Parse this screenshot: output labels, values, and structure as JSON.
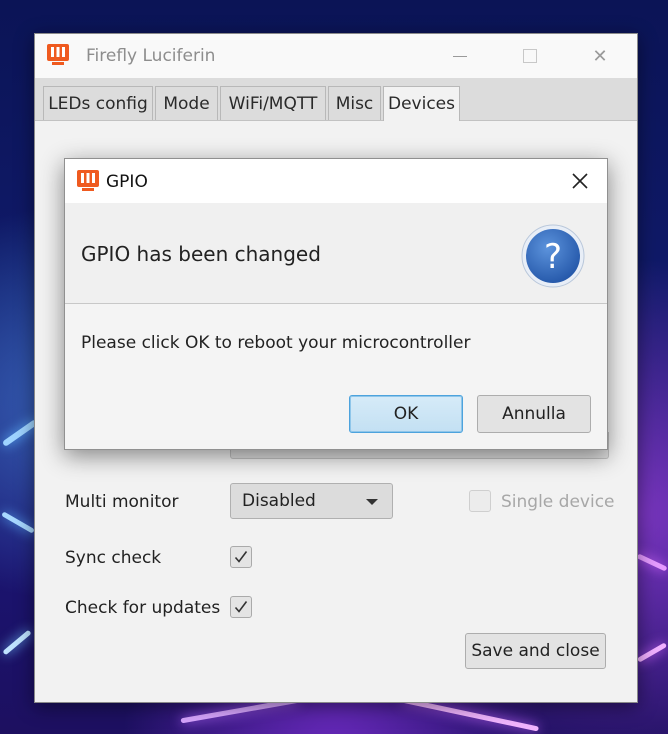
{
  "window": {
    "title": "Firefly Luciferin",
    "controls": {
      "close_glyph": "✕"
    }
  },
  "tabs": [
    {
      "label": "LEDs config",
      "active": false
    },
    {
      "label": "Mode",
      "active": false
    },
    {
      "label": "WiFi/MQTT",
      "active": false
    },
    {
      "label": "Misc",
      "active": false
    },
    {
      "label": "Devices",
      "active": true
    }
  ],
  "settings": {
    "multi_monitor": {
      "label": "Multi monitor",
      "value": "Disabled"
    },
    "single_device": {
      "label": "Single device",
      "checked": false,
      "enabled": false
    },
    "sync_check": {
      "label": "Sync check",
      "checked": true
    },
    "check_updates": {
      "label": "Check for updates",
      "checked": true
    },
    "save_button": "Save and close"
  },
  "dialog": {
    "title": "GPIO",
    "header": "GPIO has been changed",
    "content": "Please click OK to reboot your microcontroller",
    "ok_label": "OK",
    "cancel_label": "Annulla",
    "icon": "question-icon",
    "close_glyph": "✕"
  },
  "colors": {
    "app_icon": "#ef5a1f",
    "question_blue": "#2f6fc4",
    "ok_border": "#4da3dd"
  }
}
